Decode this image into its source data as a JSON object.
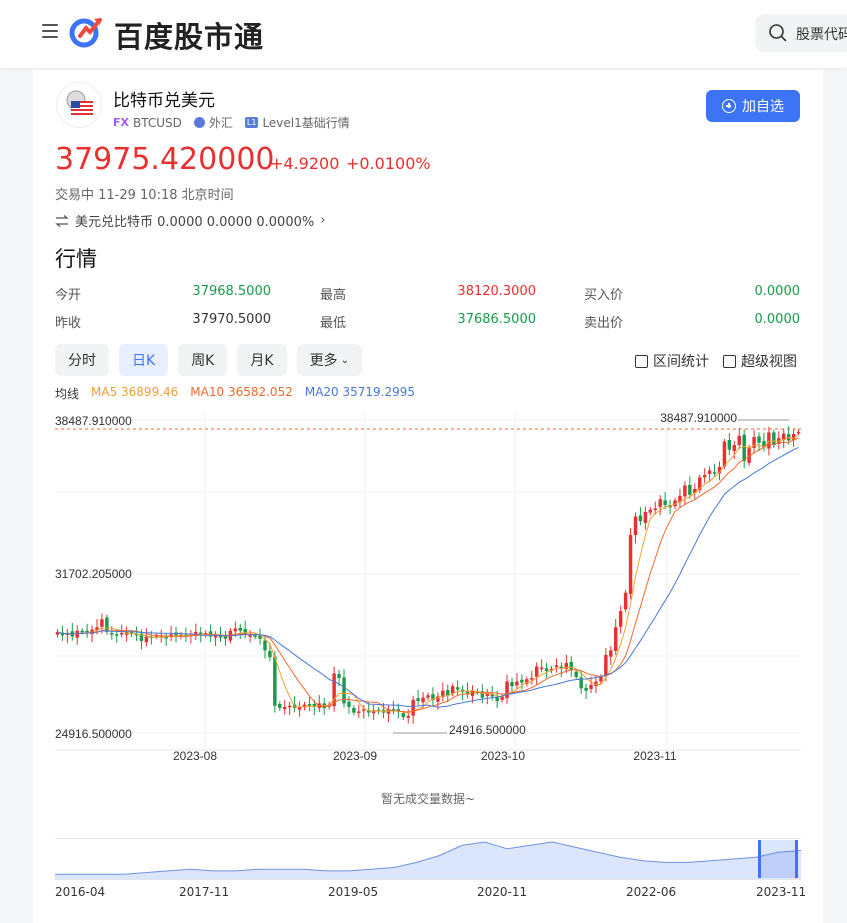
{
  "header": {
    "logo_text": "百度股市通",
    "search_placeholder": "股票代码",
    "menu_icon": "hamburger-icon",
    "search_icon": "search-icon"
  },
  "instrument": {
    "name": "比特币兑美元",
    "market_tag": "FX",
    "code": "BTCUSD",
    "category": "外汇",
    "level_tag": "L1",
    "level": "Level1基础行情",
    "add_button": "加自选",
    "price": "37975.420000",
    "change": "+4.9200",
    "change_pct": "+0.0100%",
    "status": "交易中 11-29 10:18 北京时间",
    "inverse": "美元兑比特币 0.0000 0.0000 0.0000%",
    "accent_color": "#3d73f5",
    "up_color": "#e93030",
    "down_color": "#1a9b4b"
  },
  "quotes": {
    "title": "行情",
    "open_label": "今开",
    "open": "37968.5000",
    "prev_label": "昨收",
    "prev": "37970.5000",
    "high_label": "最高",
    "high": "38120.3000",
    "low_label": "最低",
    "low": "37686.5000",
    "bid_label": "买入价",
    "bid": "0.0000",
    "ask_label": "卖出价",
    "ask": "0.0000"
  },
  "tabs": [
    {
      "label": "分时"
    },
    {
      "label": "日K"
    },
    {
      "label": "周K"
    },
    {
      "label": "月K"
    },
    {
      "label": "更多"
    }
  ],
  "tools": {
    "range_stats": "区间统计",
    "super_view": "超级视图"
  },
  "ma": {
    "label": "均线",
    "ma5": "MA5 36899.46",
    "ma10": "MA10 36582.052",
    "ma20": "MA20 35719.2995",
    "ma5_color": "#f0a030",
    "ma10_color": "#ef6a2e",
    "ma20_color": "#4a78d6"
  },
  "chart_data": {
    "type": "candlestick",
    "y_top_label": "38487.910000",
    "y_mid_label": "31702.205000",
    "y_bottom_label": "24916.500000",
    "max_marker": "38487.910000",
    "min_marker": "24916.500000",
    "ylim": [
      24916.5,
      38487.91
    ],
    "x_ticks": [
      "2023-08",
      "2023-09",
      "2023-10",
      "2023-11"
    ],
    "closes": [
      29300,
      29150,
      29250,
      29100,
      29350,
      29300,
      29280,
      29400,
      29500,
      29850,
      29300,
      29200,
      29180,
      29250,
      29300,
      29200,
      29150,
      28900,
      29100,
      29050,
      29150,
      29100,
      29050,
      29200,
      29150,
      29180,
      29100,
      29200,
      29300,
      29150,
      29250,
      29100,
      29150,
      29050,
      29000,
      29350,
      29450,
      29350,
      29200,
      29150,
      29100,
      29000,
      28500,
      28200,
      26100,
      26000,
      26050,
      26100,
      26000,
      26050,
      26150,
      26100,
      26050,
      26200,
      26000,
      26150,
      27500,
      27300,
      26200,
      26050,
      25800,
      25850,
      25950,
      25800,
      25900,
      25850,
      25800,
      25950,
      25900,
      25850,
      25600,
      25650,
      26350,
      26300,
      26450,
      26550,
      26350,
      26500,
      26750,
      26550,
      26950,
      26800,
      26700,
      26600,
      26750,
      26700,
      26450,
      26650,
      26500,
      26300,
      26500,
      27150,
      26950,
      27150,
      27100,
      27250,
      27300,
      27800,
      27750,
      27600,
      27700,
      27850,
      27700,
      27950,
      27650,
      27350,
      26850,
      26750,
      27000,
      27150,
      27350,
      28300,
      28500,
      29500,
      30200,
      31000,
      33500,
      34300,
      34100,
      34500,
      34600,
      34650,
      35050,
      34800,
      34700,
      35000,
      35200,
      35650,
      35250,
      35500,
      36000,
      36100,
      36300,
      36200,
      36450,
      37550,
      37200,
      37400,
      37800,
      36700,
      37300,
      37750,
      37500,
      37300,
      37950,
      37400,
      37700,
      37900,
      37600,
      37880,
      37975
    ],
    "grid": true,
    "volume_note": "暂无成交量数据~"
  },
  "navigator": {
    "ticks": [
      "2016-04",
      "2017-11",
      "2019-05",
      "2020-11",
      "2022-06",
      "2023-11"
    ],
    "series": [
      1,
      1,
      1,
      1,
      2,
      3,
      4,
      3,
      3,
      4,
      4,
      4,
      3,
      3,
      4,
      5,
      8,
      12,
      18,
      20,
      16,
      18,
      20,
      17,
      14,
      11,
      9,
      8,
      8,
      9,
      10,
      11,
      14,
      15
    ]
  }
}
